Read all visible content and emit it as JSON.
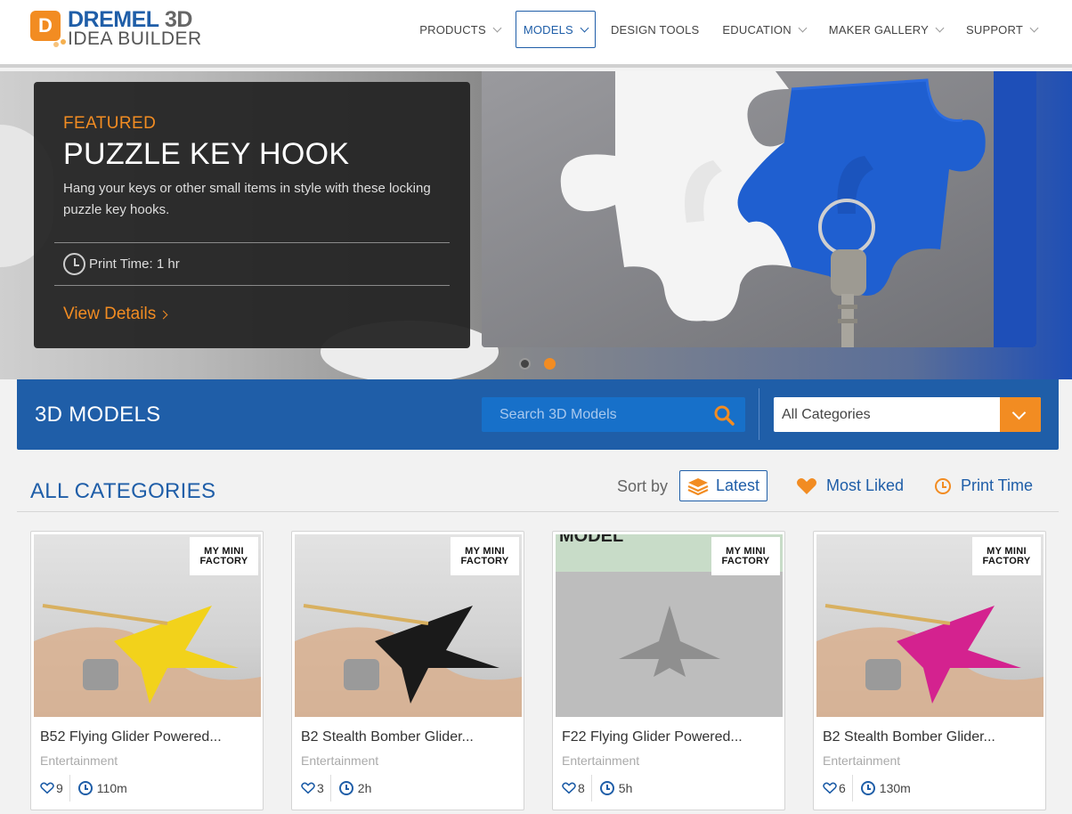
{
  "brand": {
    "logo_letter": "D",
    "line1a": "DREMEL",
    "line1b": "3D",
    "line2": "IDEA BUILDER"
  },
  "nav": [
    {
      "label": "PRODUCTS",
      "has_menu": true,
      "active": false
    },
    {
      "label": "MODELS",
      "has_menu": true,
      "active": true
    },
    {
      "label": "DESIGN TOOLS",
      "has_menu": false,
      "active": false
    },
    {
      "label": "EDUCATION",
      "has_menu": true,
      "active": false
    },
    {
      "label": "MAKER GALLERY",
      "has_menu": true,
      "active": false
    },
    {
      "label": "SUPPORT",
      "has_menu": true,
      "active": false
    }
  ],
  "hero": {
    "label": "FEATURED",
    "title": "PUZZLE KEY HOOK",
    "description": "Hang your keys or other small items in style with these locking puzzle key hooks.",
    "print_time": "Print Time: 1 hr",
    "link": "View Details",
    "slides": 2,
    "active_slide": 2
  },
  "models_bar": {
    "title": "3D MODELS",
    "search_placeholder": "Search 3D Models",
    "category_value": "All Categories"
  },
  "listing": {
    "title": "ALL CATEGORIES",
    "sort_label": "Sort by",
    "sort_options": {
      "latest": "Latest",
      "most_liked": "Most Liked",
      "print_time": "Print Time"
    },
    "active_sort": "latest"
  },
  "cards": [
    {
      "title": "B52 Flying Glider Powered...",
      "category": "Entertainment",
      "likes": "9",
      "time": "110m",
      "badge_line1": "MY MINI",
      "badge_line2": "FACTORY",
      "plane_color": "#f2d21b"
    },
    {
      "title": "B2 Stealth Bomber Glider...",
      "category": "Entertainment",
      "likes": "3",
      "time": "2h",
      "badge_line1": "MY MINI",
      "badge_line2": "FACTORY",
      "plane_color": "#1a1a1a"
    },
    {
      "title": "F22 Flying Glider Powered...",
      "category": "Entertainment",
      "likes": "8",
      "time": "5h",
      "badge_line1": "MY MINI",
      "badge_line2": "FACTORY",
      "plane_color": "#8f8f8f",
      "banner_text": "MODEL"
    },
    {
      "title": "B2 Stealth Bomber Glider...",
      "category": "Entertainment",
      "likes": "6",
      "time": "130m",
      "badge_line1": "MY MINI",
      "badge_line2": "FACTORY",
      "plane_color": "#d4228f"
    }
  ],
  "colors": {
    "brand_blue": "#1f5ea8",
    "accent_orange": "#f28c22"
  }
}
